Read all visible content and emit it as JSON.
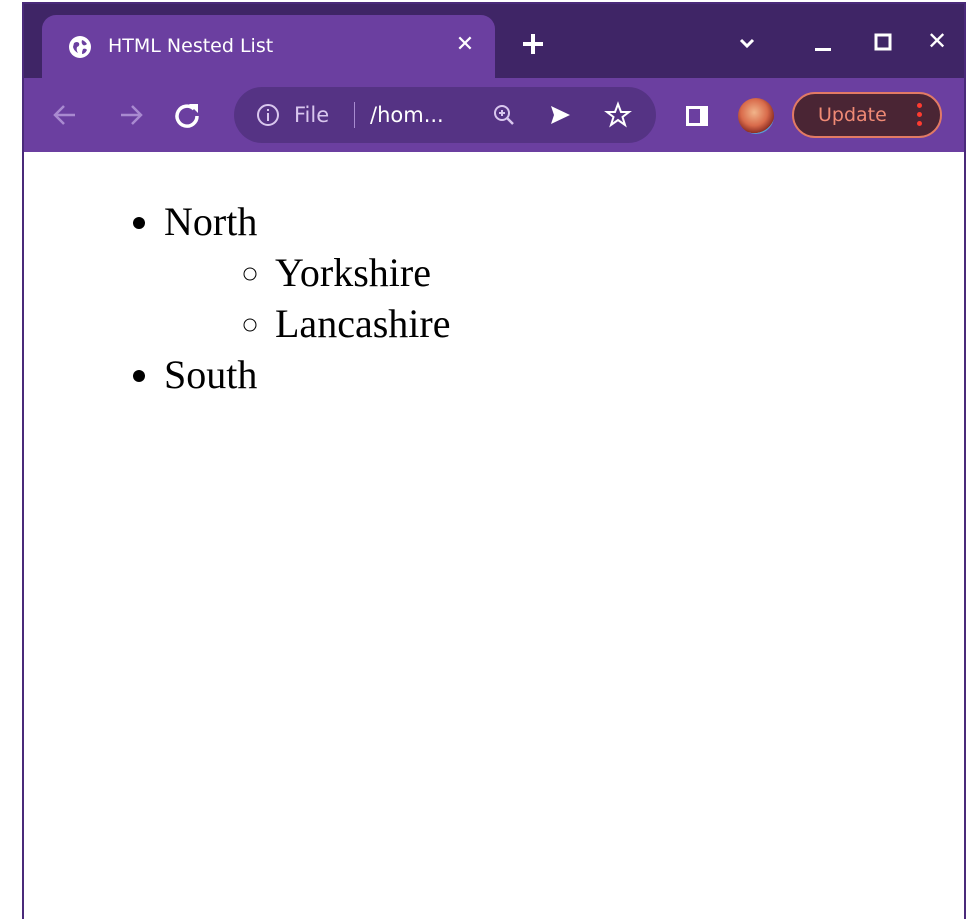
{
  "browser": {
    "tab": {
      "title": "HTML Nested List",
      "favicon": "globe-icon",
      "close_icon": "close-icon"
    },
    "new_tab_icon": "plus-icon",
    "window_controls": {
      "dropdown_icon": "chevron-down-icon",
      "minimize_icon": "minimize-icon",
      "maximize_icon": "maximize-icon",
      "close_icon": "close-icon"
    },
    "toolbar": {
      "back_icon": "back-arrow-icon",
      "forward_icon": "forward-arrow-icon",
      "reload_icon": "reload-icon",
      "omnibox": {
        "info_icon": "info-icon",
        "scheme": "File",
        "url": "/hom..."
      },
      "zoom_icon": "zoom-in-icon",
      "send_icon": "send-icon",
      "star_icon": "star-icon",
      "side_panel_icon": "side-panel-icon",
      "avatar": "avatar",
      "update_label": "Update",
      "menu_icon": "kebab-menu-icon"
    }
  },
  "colors": {
    "titlebar": "#3f2566",
    "tab_active": "#6b3fa0",
    "toolbar": "#6b3fa0",
    "omnibox": "#553384",
    "update_text": "#f08a75",
    "update_border": "#e27a64",
    "menu_dots": "#ff3b30"
  },
  "page": {
    "list": [
      {
        "label": "North",
        "children": [
          "Yorkshire",
          "Lancashire"
        ]
      },
      {
        "label": "South"
      }
    ]
  }
}
